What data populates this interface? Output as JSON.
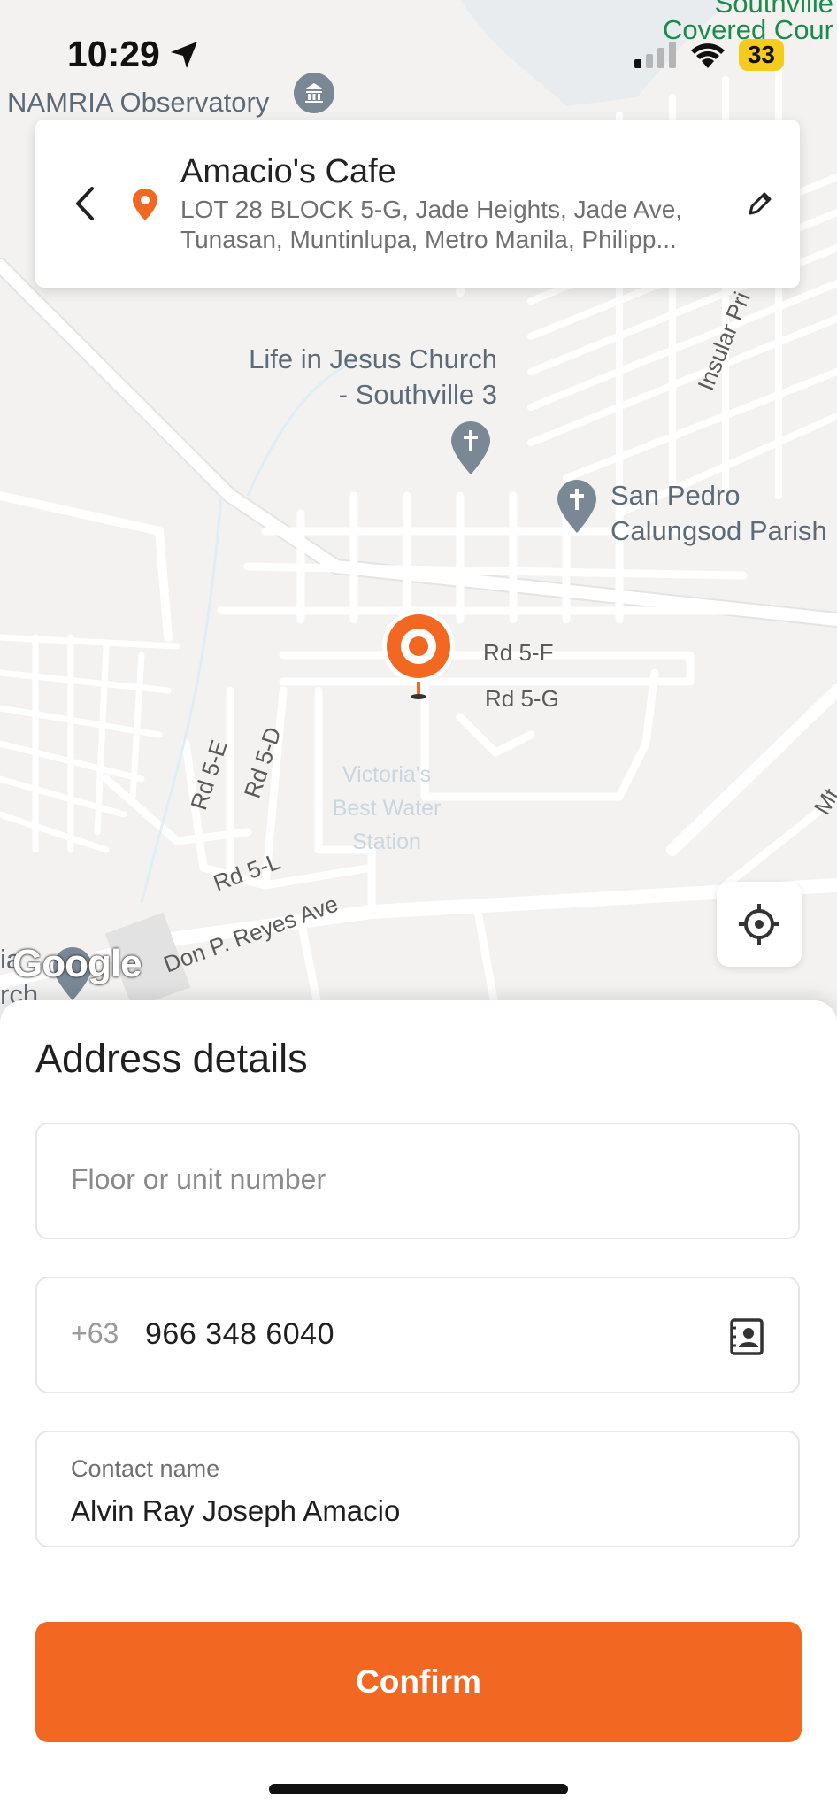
{
  "status_bar": {
    "time": "10:29",
    "battery": "33"
  },
  "map": {
    "top_label": "NAMRIA Observatory",
    "corner_labels": [
      "Southville",
      "Covered Cour"
    ],
    "church_1": [
      "Life in Jesus Church",
      "- Southville 3"
    ],
    "church_2": [
      "San Pedro",
      "Calungsod Parish"
    ],
    "roads": [
      "Rd 5-F",
      "Rd 5-G",
      "Rd 5-E",
      "Rd 5-D",
      "Rd 5-L",
      "Don P. Reyes Ave",
      "Insular Pri",
      "Mt"
    ],
    "faded_label": [
      "Victoria's",
      "Best Water",
      "Station"
    ],
    "edge_label": [
      "ia",
      "rch"
    ],
    "google": "Google"
  },
  "address_card": {
    "title": "Amacio's Cafe",
    "line1": "LOT 28 BLOCK 5-G, Jade Heights, Jade Ave,",
    "line2": "Tunasan, Muntinlupa, Metro Manila, Philipp..."
  },
  "sheet": {
    "title": "Address details",
    "floor_placeholder": "Floor or unit number",
    "phone_prefix": "+63",
    "phone": "966 348 6040",
    "contact_label": "Contact name",
    "contact_name": "Alvin Ray Joseph Amacio",
    "confirm": "Confirm"
  },
  "colors": {
    "accent": "#f26822",
    "pin_gray": "#7a8896"
  }
}
